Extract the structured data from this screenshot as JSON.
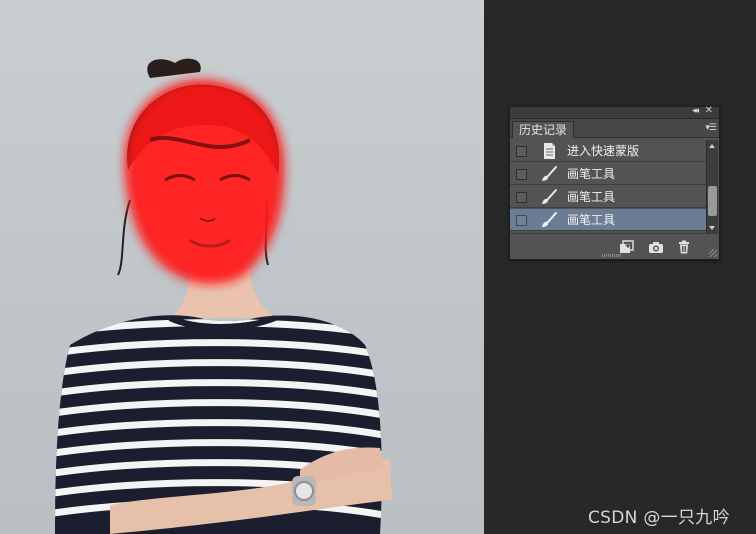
{
  "canvas": {
    "subject": "photo-portrait",
    "mask_color": "#ff2a2a"
  },
  "history_panel": {
    "tab_label": "历史记录",
    "items": [
      {
        "label": "进入快速蒙版",
        "icon": "document-icon",
        "selected": false
      },
      {
        "label": "画笔工具",
        "icon": "brush-icon",
        "selected": false
      },
      {
        "label": "画笔工具",
        "icon": "brush-icon",
        "selected": false
      },
      {
        "label": "画笔工具",
        "icon": "brush-icon",
        "selected": true
      }
    ],
    "footer_icons": [
      "new-document-icon",
      "camera-icon",
      "trash-icon"
    ],
    "accent": "#6b7d94"
  },
  "watermark": {
    "text": "CSDN @一只九吟"
  }
}
